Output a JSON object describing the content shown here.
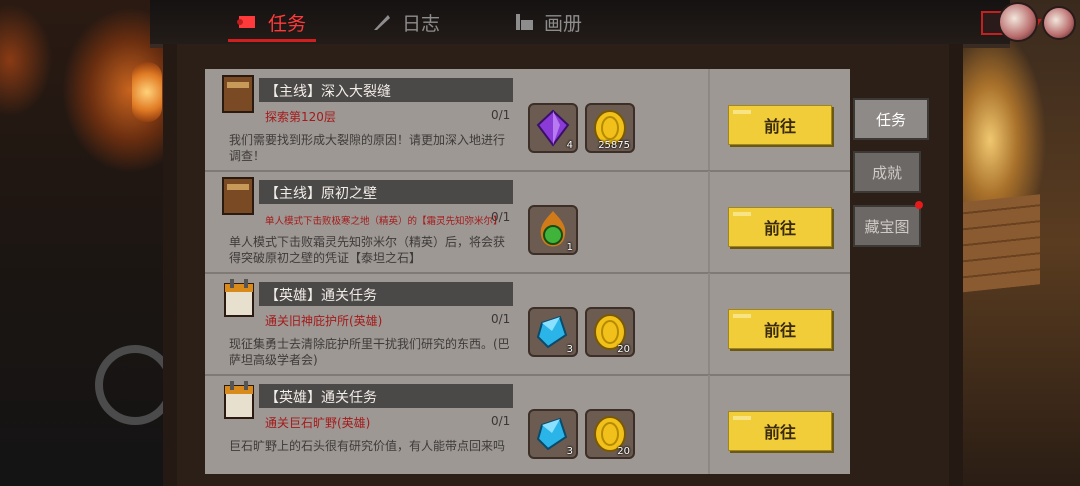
{
  "tabs": [
    {
      "label": "任务",
      "active": true
    },
    {
      "label": "日志",
      "active": false
    },
    {
      "label": "画册",
      "active": false
    }
  ],
  "side_tabs": [
    {
      "label": "任务",
      "active": true
    },
    {
      "label": "成就",
      "active": false
    },
    {
      "label": "藏宝图",
      "active": false,
      "has_dot": true
    }
  ],
  "quests": [
    {
      "icon": "book-icon",
      "title": "【主线】深入大裂缝",
      "objective": "探索第120层",
      "progress": "0/1",
      "description": "我们需要找到形成大裂隙的原因！请更加深入地进行调查！",
      "rewards": [
        {
          "icon": "purple-gem-icon",
          "count": "4"
        },
        {
          "icon": "gold-coin-icon",
          "count": "25875"
        }
      ],
      "button": "前往"
    },
    {
      "icon": "book-icon",
      "title": "【主线】原初之壁",
      "objective": "单人模式下击败极寒之地（精英）的【霜灵先知弥米尔】",
      "progress": "0/1",
      "description": "单人模式下击败霜灵先知弥米尔（精英）后，将会获得突破原初之壁的凭证【泰坦之石】",
      "rewards": [
        {
          "icon": "titan-stone-icon",
          "count": "1"
        }
      ],
      "button": "前往"
    },
    {
      "icon": "calendar-icon",
      "title": "【英雄】通关任务",
      "objective": "通关旧神庇护所(英雄)",
      "progress": "0/1",
      "description": "现征集勇士去清除庇护所里干扰我们研究的东西。(巴萨坦高级学者会)",
      "rewards": [
        {
          "icon": "blue-crystal-icon",
          "count": "3"
        },
        {
          "icon": "gold-coin-icon",
          "count": "20"
        }
      ],
      "button": "前往"
    },
    {
      "icon": "calendar-icon",
      "title": "【英雄】通关任务",
      "objective": "通关巨石旷野(英雄)",
      "progress": "0/1",
      "description": "巨石旷野上的石头很有研究价值，有人能带点回来吗",
      "rewards": [
        {
          "icon": "blue-crystal-icon",
          "count": "3"
        },
        {
          "icon": "gold-coin-icon",
          "count": "20"
        }
      ],
      "button": "前往"
    }
  ],
  "colors": {
    "accent": "#f1cd3a",
    "tab_active": "#ff3a3a",
    "objective": "#a51a1a"
  }
}
